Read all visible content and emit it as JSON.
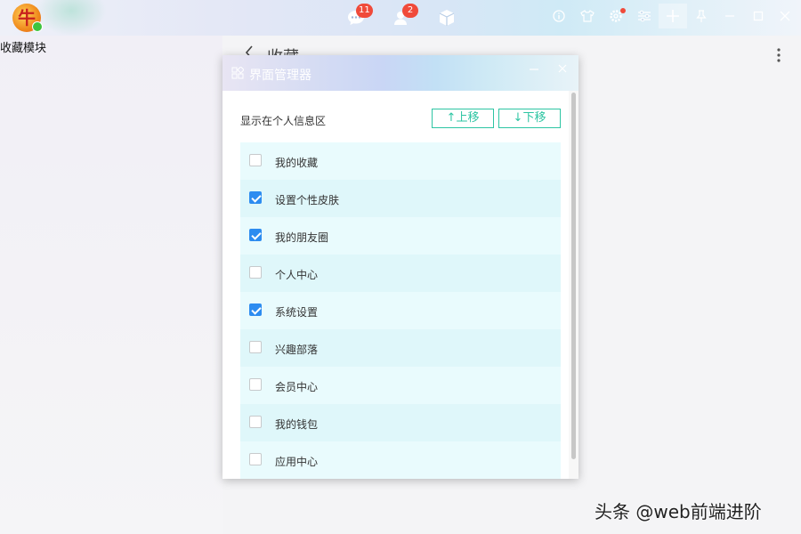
{
  "app": {
    "logo_char": "牛"
  },
  "topbar": {
    "messages_badge": "11",
    "contacts_badge": "2"
  },
  "sidebar": {
    "title": "收藏模块"
  },
  "main": {
    "title": "收藏"
  },
  "dialog": {
    "title": "界面管理器",
    "section_label": "显示在个人信息区",
    "move_up_label": "↑上移",
    "move_down_label": "↓下移",
    "items": [
      {
        "label": "我的收藏",
        "checked": false
      },
      {
        "label": "设置个性皮肤",
        "checked": true
      },
      {
        "label": "我的朋友圈",
        "checked": true
      },
      {
        "label": "个人中心",
        "checked": false
      },
      {
        "label": "系统设置",
        "checked": true
      },
      {
        "label": "兴趣部落",
        "checked": false
      },
      {
        "label": "会员中心",
        "checked": false
      },
      {
        "label": "我的钱包",
        "checked": false
      },
      {
        "label": "应用中心",
        "checked": false
      }
    ]
  },
  "watermark": "头条 @web前端进阶",
  "colors": {
    "accent_green": "#2ec5a3",
    "checkbox_blue": "#2d8cf0",
    "badge_red": "#f04a3a"
  }
}
